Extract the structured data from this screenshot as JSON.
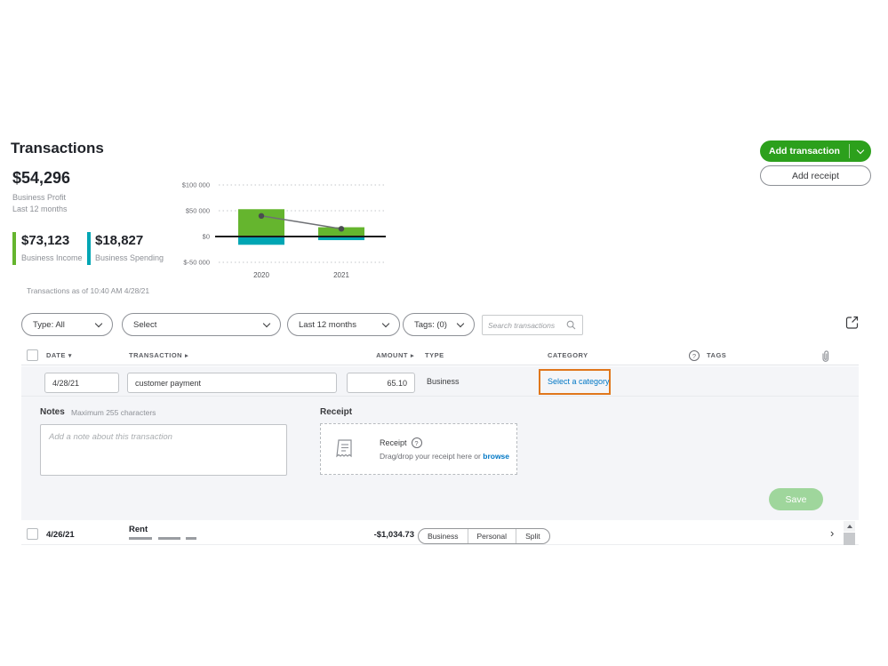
{
  "page": {
    "title": "Transactions"
  },
  "actions": {
    "add_transaction": "Add transaction",
    "add_receipt": "Add receipt"
  },
  "stats": {
    "profit": {
      "amount": "$54,296",
      "label1": "Business Profit",
      "label2": "Last 12 months"
    },
    "income": {
      "amount": "$73,123",
      "label": "Business Income"
    },
    "spending": {
      "amount": "$18,827",
      "label": "Business Spending"
    }
  },
  "chart_data": {
    "type": "bar",
    "subtype": "bars-with-trend-line",
    "title": "",
    "categories": [
      "2020",
      "2021"
    ],
    "series": [
      {
        "name": "Business Income",
        "type": "bar",
        "color": "#65b52e",
        "values": [
          53000,
          18000
        ]
      },
      {
        "name": "Business Spending",
        "type": "bar",
        "color": "#00a6b4",
        "values": [
          -16000,
          -7000
        ]
      },
      {
        "name": "Profit trend",
        "type": "line",
        "color": "#6e7074",
        "values": [
          40000,
          15000
        ]
      }
    ],
    "yticks": [
      {
        "label": "$100 000",
        "value": 100000
      },
      {
        "label": "$50 000",
        "value": 50000
      },
      {
        "label": "$0",
        "value": 0
      },
      {
        "label": "$-50 000",
        "value": -50000
      }
    ],
    "ylim": [
      -62000,
      118000
    ],
    "grid": "dotted horizontal",
    "zero_line": true,
    "legend": "none"
  },
  "meta_line": "Transactions as of 10:40 AM 4/28/21",
  "filters": {
    "type": "Type: All",
    "select": "Select",
    "period": "Last 12 months",
    "tags": "Tags: (0)",
    "search_placeholder": "Search transactions"
  },
  "table": {
    "headers": {
      "date": "DATE",
      "date_arrow": "▾",
      "transaction": "TRANSACTION",
      "transaction_arrow": "▸",
      "amount": "AMOUNT",
      "amount_arrow": "▸",
      "type": "TYPE",
      "category": "CATEGORY",
      "tags": "TAGS",
      "help_glyph": "?"
    }
  },
  "editor": {
    "date_value": "4/28/21",
    "transaction_value": "customer payment",
    "amount_value": "65.10",
    "type_value": "Business",
    "category_link": "Select a category",
    "notes_label": "Notes",
    "notes_hint": "Maximum 255 characters",
    "notes_placeholder": "Add a note about this transaction",
    "receipt_label": "Receipt",
    "receipt_title": "Receipt",
    "receipt_help": "?",
    "receipt_drag": "Drag/drop your receipt here or",
    "receipt_browse": "browse",
    "save": "Save"
  },
  "row2": {
    "date": "4/26/21",
    "name": "Rent",
    "amount": "-$1,034.73",
    "segments": [
      "Business",
      "Personal",
      "Split"
    ],
    "chevron": "›"
  },
  "colors": {
    "qb_green": "#2ca01c",
    "bar_green": "#65b52e",
    "teal": "#00a6b4",
    "highlight_orange": "#e0771c",
    "link_blue": "#0077c5",
    "save_green": "#9fd69c"
  }
}
